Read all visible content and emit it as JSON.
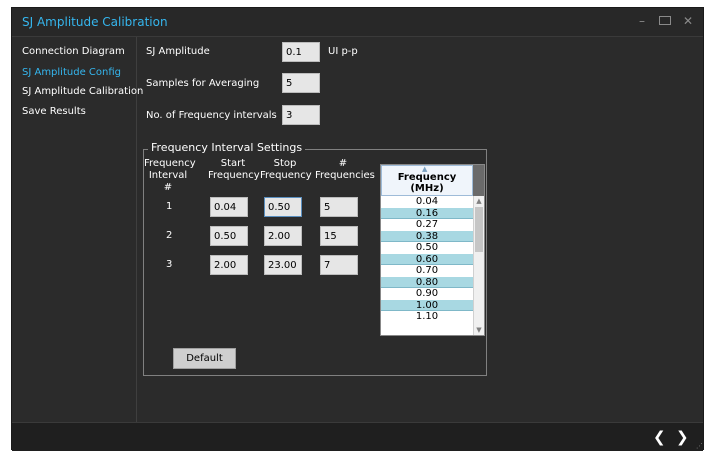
{
  "window": {
    "title": "SJ Amplitude Calibration",
    "controls": {
      "minimize": "–",
      "close": "✕"
    }
  },
  "sidebar": {
    "items": [
      {
        "label": "Connection Diagram",
        "active": false
      },
      {
        "label": "SJ Amplitude Config",
        "active": true
      },
      {
        "label": "SJ Amplitude Calibration",
        "active": false
      },
      {
        "label": "Save Results",
        "active": false
      }
    ]
  },
  "form": {
    "sj_amplitude": {
      "label": "SJ Amplitude",
      "value": "0.1",
      "unit": "UI p-p"
    },
    "samples": {
      "label": "Samples for Averaging",
      "value": "5"
    },
    "intervals": {
      "label": "No. of Frequency intervals",
      "value": "3"
    }
  },
  "group": {
    "title": "Frequency Interval Settings",
    "headers": {
      "interval": [
        "Frequency",
        "Interval #"
      ],
      "start": [
        "Start",
        "Frequency"
      ],
      "stop": [
        "Stop",
        "Frequency"
      ],
      "count": [
        "#",
        "Frequencies"
      ]
    },
    "rows": [
      {
        "num": "1",
        "start": "0.04",
        "stop": "0.50",
        "count": "5"
      },
      {
        "num": "2",
        "start": "0.50",
        "stop": "2.00",
        "count": "15"
      },
      {
        "num": "3",
        "start": "2.00",
        "stop": "23.00",
        "count": "7"
      }
    ],
    "default_button": "Default"
  },
  "frequency_table": {
    "header": [
      "Frequency",
      "(MHz)"
    ],
    "sort_glyph": "▲",
    "scroll_up": "▲",
    "scroll_down": "▼",
    "values": [
      "0.04",
      "0.16",
      "0.27",
      "0.38",
      "0.50",
      "0.60",
      "0.70",
      "0.80",
      "0.90",
      "1.00",
      "1.10"
    ]
  },
  "footer": {
    "prev": "❮",
    "next": "❯",
    "grip": "⋰"
  },
  "colors": {
    "accent": "#35b6ee",
    "background": "#2b2b2b",
    "row_alt": "#a8d8e2"
  }
}
